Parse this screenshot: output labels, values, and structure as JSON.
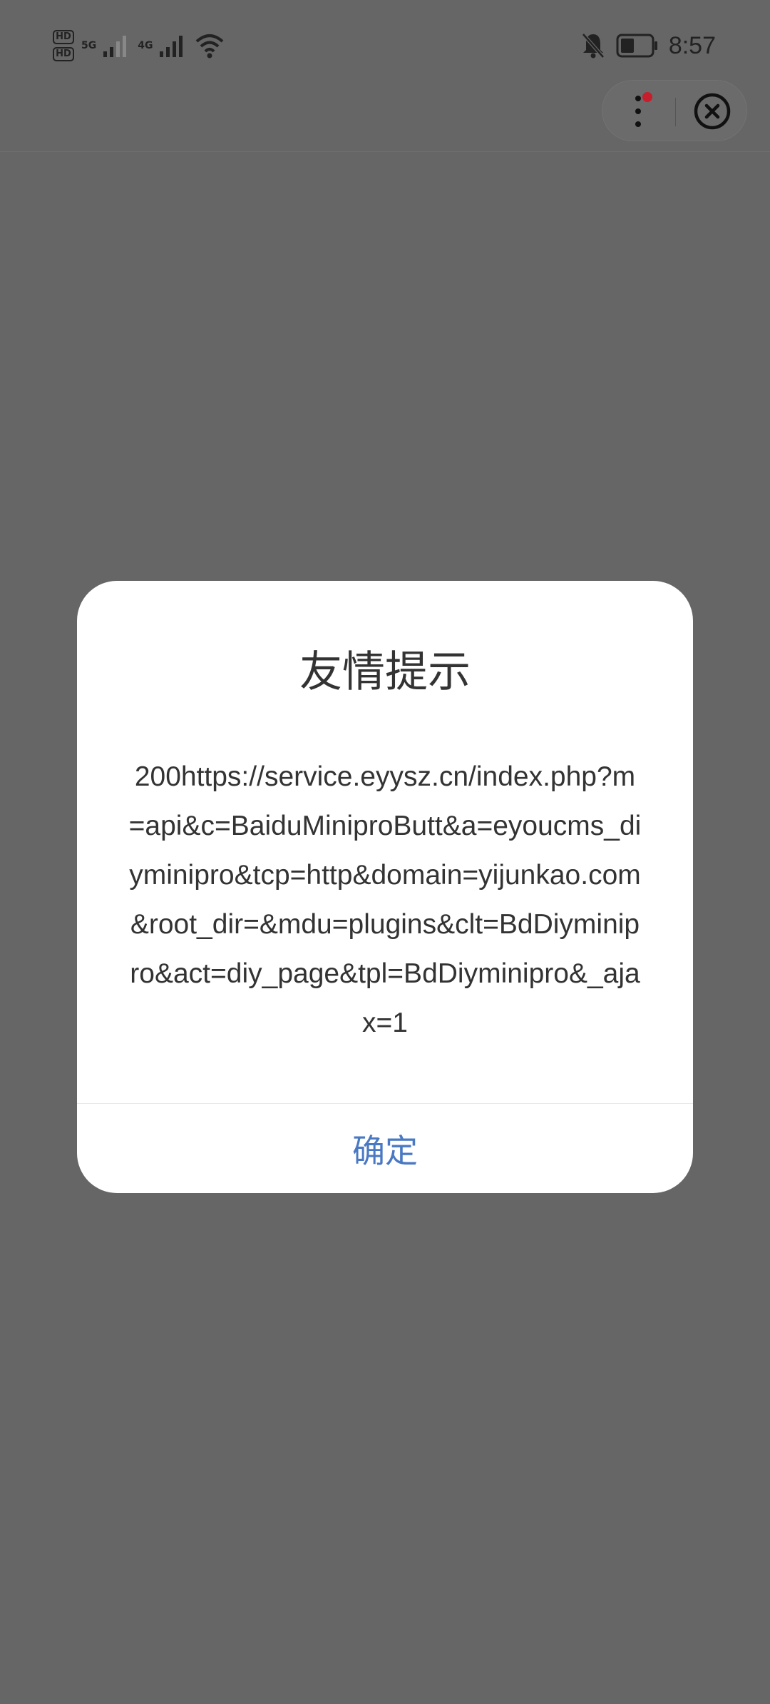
{
  "status_bar": {
    "hd1": "HD",
    "hd2": "HD",
    "sim1_tag": "5G",
    "sim2_tag": "4G",
    "time": "8:57",
    "icons": [
      "hd-icon",
      "signal-5g-icon",
      "signal-4g-icon",
      "wifi-icon",
      "bell-muted-icon",
      "battery-icon"
    ]
  },
  "capsule": {
    "icons": [
      "more-dots-icon",
      "close-circle-icon"
    ],
    "badge_color": "#c71e2d"
  },
  "dialog": {
    "title": "友情提示",
    "message": "200https://service.eyysz.cn/index.php?m=api&c=BaiduMiniproButt&a=eyoucms_diyminipro&tcp=http&domain=yijunkao.com&root_dir=&mdu=plugins&clt=BdDiyminipro&act=diy_page&tpl=BdDiyminipro&_ajax=1",
    "confirm_label": "确定",
    "accent_color": "#4a79c4"
  },
  "colors": {
    "overlay": "#666666",
    "dialog_bg": "#ffffff",
    "text": "#333333"
  }
}
